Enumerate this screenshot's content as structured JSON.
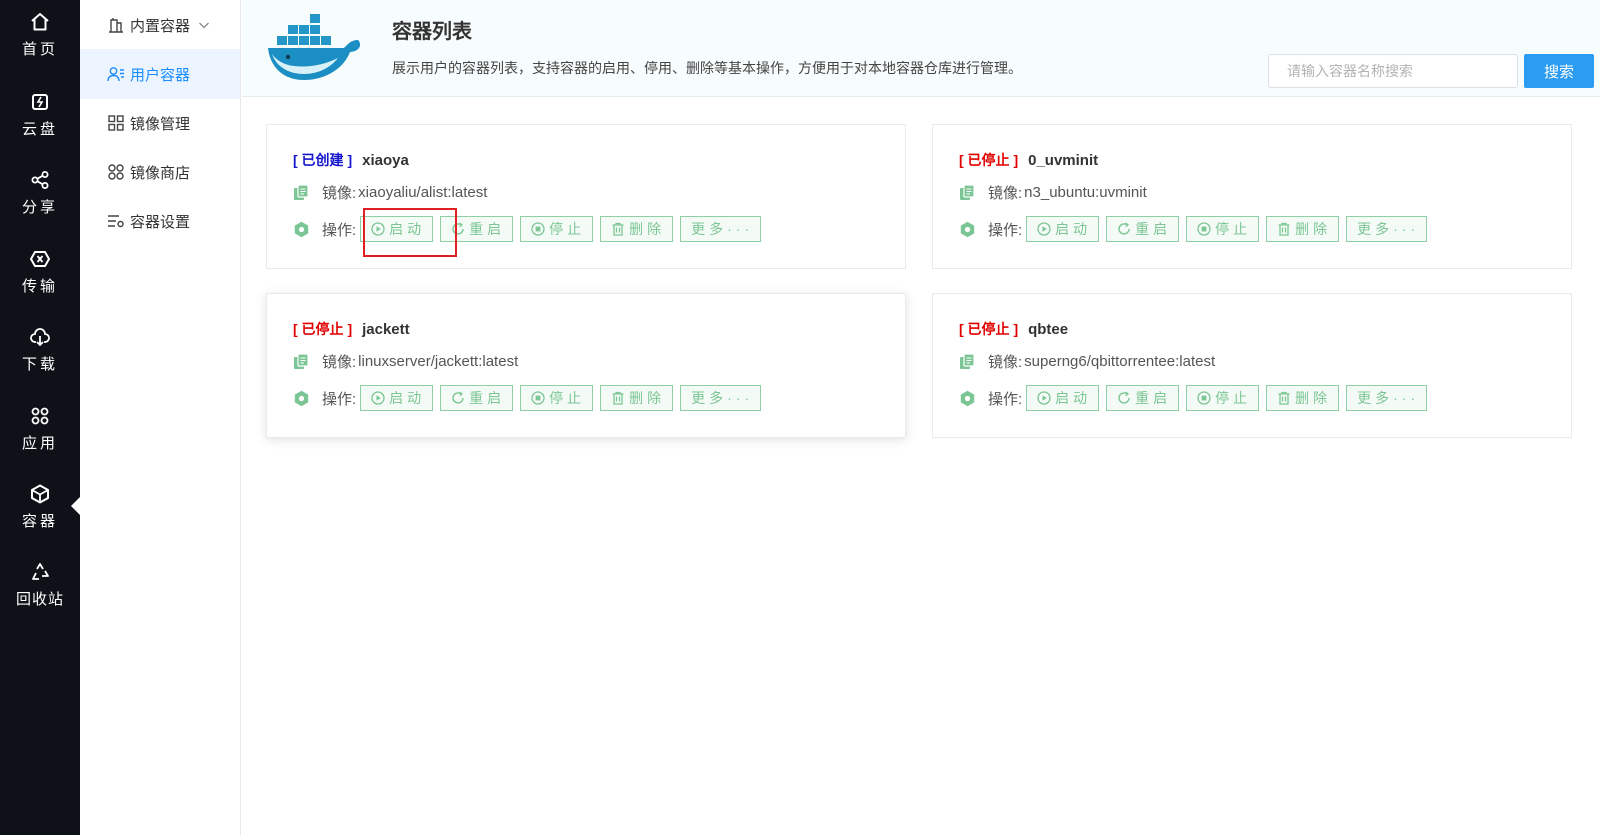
{
  "nav": [
    {
      "label": "首页",
      "icon": "home-icon"
    },
    {
      "label": "云盘",
      "icon": "cloud-disk-icon"
    },
    {
      "label": "分享",
      "icon": "share-icon"
    },
    {
      "label": "传输",
      "icon": "transfer-icon"
    },
    {
      "label": "下载",
      "icon": "download-icon"
    },
    {
      "label": "应用",
      "icon": "apps-icon"
    },
    {
      "label": "容器",
      "icon": "container-icon",
      "active": true
    },
    {
      "label": "回收站",
      "icon": "recycle-icon"
    }
  ],
  "subnav": [
    {
      "label": "内置容器",
      "icon": "building-icon",
      "expandable": true
    },
    {
      "label": "用户容器",
      "icon": "user-list-icon",
      "active": true
    },
    {
      "label": "镜像管理",
      "icon": "grid-icon"
    },
    {
      "label": "镜像商店",
      "icon": "store-icon"
    },
    {
      "label": "容器设置",
      "icon": "settings-list-icon"
    }
  ],
  "header": {
    "title": "容器列表",
    "description": "展示用户的容器列表，支持容器的启用、停用、删除等基本操作，方便用于对本地容器仓库进行管理。",
    "search_placeholder": "请输入容器名称搜索",
    "search_button": "搜索"
  },
  "labels": {
    "image": "镜像:",
    "ops": "操作:"
  },
  "actions": {
    "start": "启动",
    "restart": "重启",
    "stop": "停止",
    "delete": "删除",
    "more": "更多···"
  },
  "containers": [
    {
      "status": "[ 已创建 ]",
      "status_color": "#1515cc",
      "name": "xiaoya",
      "image": "xiaoyaliu/alist:latest"
    },
    {
      "status": "[ 已停止 ]",
      "status_color": "#e00000",
      "name": "0_uvminit",
      "image": "n3_ubuntu:uvminit"
    },
    {
      "status": "[ 已停止 ]",
      "status_color": "#e00000",
      "name": "jackett",
      "image": "linuxserver/jackett:latest"
    },
    {
      "status": "[ 已停止 ]",
      "status_color": "#e00000",
      "name": "qbtee",
      "image": "superng6/qbittorrentee:latest"
    }
  ],
  "colors": {
    "nav_bg": "#0e1117",
    "accent": "#2b9cf2",
    "action_green": "#7cc594",
    "highlight": "#e02020"
  }
}
